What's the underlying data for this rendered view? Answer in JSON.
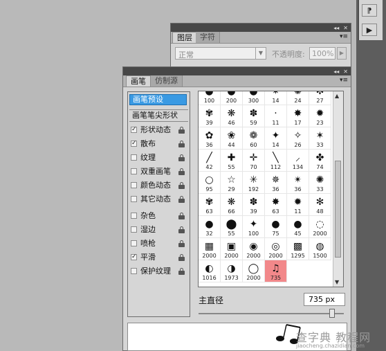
{
  "layers_panel": {
    "tabs": [
      "图层",
      "字符"
    ],
    "blend_mode": "正常",
    "opacity_label": "不透明度:",
    "opacity_value": "100%"
  },
  "brush_panel": {
    "tabs": [
      "画笔",
      "仿制源"
    ],
    "presets_button": "画笔预设",
    "tip_shape_label": "画笔笔尖形状",
    "options": [
      {
        "label": "形状动态",
        "checked": true
      },
      {
        "label": "散布",
        "checked": true
      },
      {
        "label": "纹理",
        "checked": false
      },
      {
        "label": "双重画笔",
        "checked": false
      },
      {
        "label": "颜色动态",
        "checked": false
      },
      {
        "label": "其它动态",
        "checked": false
      },
      {
        "label": "杂色",
        "checked": false
      },
      {
        "label": "湿边",
        "checked": false
      },
      {
        "label": "喷枪",
        "checked": false
      },
      {
        "label": "平滑",
        "checked": true
      },
      {
        "label": "保护纹理",
        "checked": false
      }
    ],
    "brush_sizes": [
      "100",
      "200",
      "300",
      "14",
      "24",
      "27",
      "39",
      "46",
      "59",
      "11",
      "17",
      "23",
      "36",
      "44",
      "60",
      "14",
      "26",
      "33",
      "42",
      "55",
      "70",
      "112",
      "134",
      "74",
      "95",
      "29",
      "192",
      "36",
      "36",
      "33",
      "63",
      "66",
      "39",
      "63",
      "11",
      "48",
      "32",
      "55",
      "100",
      "75",
      "45",
      "2000",
      "2000",
      "2000",
      "2000",
      "2000",
      "1295",
      "1500",
      "1016",
      "1973",
      "2000",
      "735"
    ],
    "brush_glyphs": [
      "●",
      "●",
      "●",
      "✷",
      "✺",
      "✻",
      "✾",
      "❋",
      "✽",
      "·",
      "✸",
      "✹",
      "✿",
      "❀",
      "❁",
      "✦",
      "✧",
      "✶",
      "╱",
      "✚",
      "✛",
      "╲",
      "⸝",
      "✤",
      "○",
      "☆",
      "✳",
      "✵",
      "✴",
      "✺",
      "✾",
      "❋",
      "✽",
      "✸",
      "✹",
      "✻",
      "●",
      "⬤",
      "✦",
      "●",
      "●",
      "◌",
      "▦",
      "▣",
      "◉",
      "◎",
      "▩",
      "◍",
      "◐",
      "◑",
      "◯",
      "♫"
    ],
    "selected_index": 51,
    "diameter_label": "主直径",
    "diameter_value": "735 px",
    "diameter_fraction": 0.92
  },
  "dock": {
    "btn1_icon": "layers-tool-icon",
    "btn2_icon": "play-icon"
  },
  "watermark": {
    "main": "查字典 教程网",
    "sub": "jiaocheng.chazidian.com"
  }
}
